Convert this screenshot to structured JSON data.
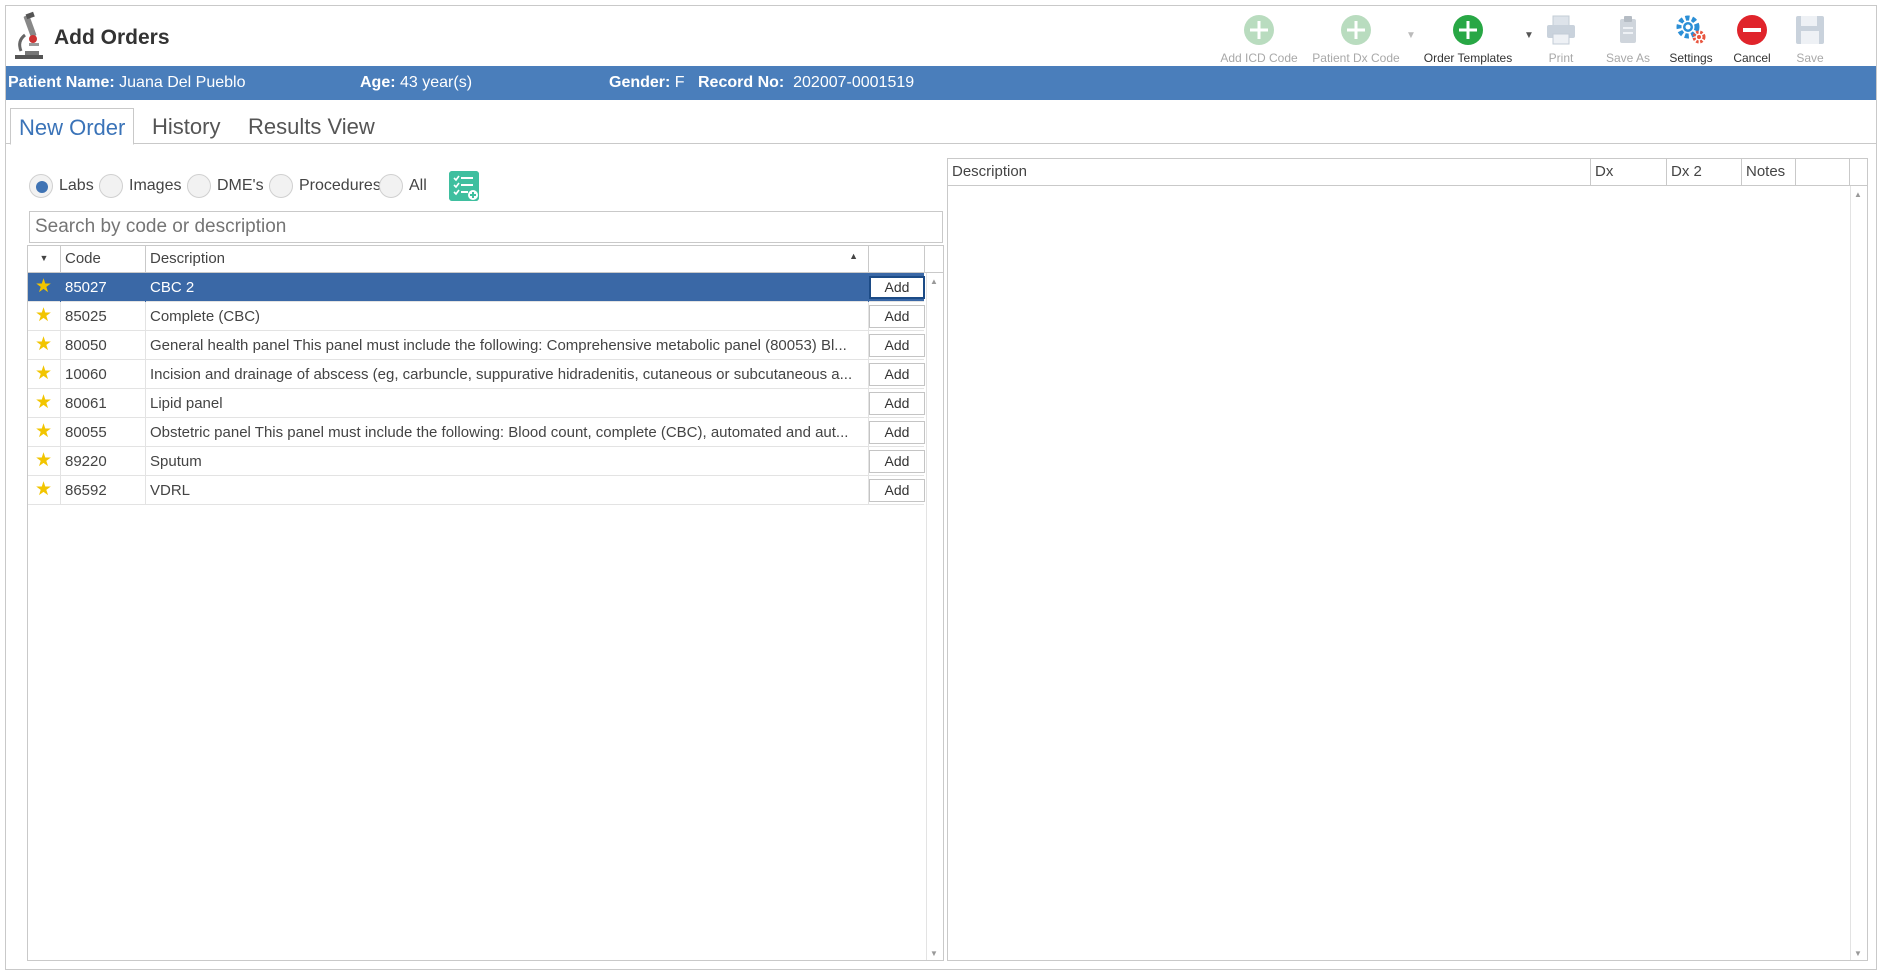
{
  "app": {
    "title": "Add Orders",
    "icon": "microscope-icon"
  },
  "toolbar": {
    "add_icd_code": "Add ICD Code",
    "patient_dx_code": "Patient Dx Code",
    "order_templates": "Order Templates",
    "print": "Print",
    "save_as": "Save As",
    "settings": "Settings",
    "cancel": "Cancel",
    "save": "Save"
  },
  "patient": {
    "name_label": "Patient Name:",
    "name": "Juana Del Pueblo",
    "age_label": "Age:",
    "age": "43 year(s)",
    "gender_label": "Gender:",
    "gender": "F",
    "record_label": "Record No:",
    "record": "202007-0001519"
  },
  "tabs": [
    "New Order",
    "History",
    "Results View"
  ],
  "filters": {
    "options": [
      "Labs",
      "Images",
      "DME's",
      "Procedures",
      "All"
    ],
    "selected": "Labs"
  },
  "search": {
    "placeholder": "Search by code or description",
    "value": ""
  },
  "grid": {
    "headers": {
      "code": "Code",
      "description": "Description"
    },
    "add_label": "Add",
    "rows": [
      {
        "code": "85027",
        "description": "CBC 2"
      },
      {
        "code": "85025",
        "description": "Complete (CBC)"
      },
      {
        "code": "80050",
        "description": "General health panel This panel must include the following: Comprehensive metabolic panel (80053) Bl..."
      },
      {
        "code": "10060",
        "description": "Incision and drainage of abscess (eg, carbuncle, suppurative hidradenitis, cutaneous or subcutaneous a..."
      },
      {
        "code": "80061",
        "description": "Lipid panel"
      },
      {
        "code": "80055",
        "description": "Obstetric panel This panel must include the following: Blood count, complete (CBC), automated and aut..."
      },
      {
        "code": "89220",
        "description": "Sputum"
      },
      {
        "code": "86592",
        "description": "VDRL"
      }
    ]
  },
  "orders_grid": {
    "headers": {
      "description": "Description",
      "dx": "Dx",
      "dx2": "Dx 2",
      "notes": "Notes"
    }
  },
  "colors": {
    "header_bar": "#4a7ebb",
    "selected_row": "#3a68a6",
    "accent": "#3a73b8",
    "star": "#f2c500"
  }
}
